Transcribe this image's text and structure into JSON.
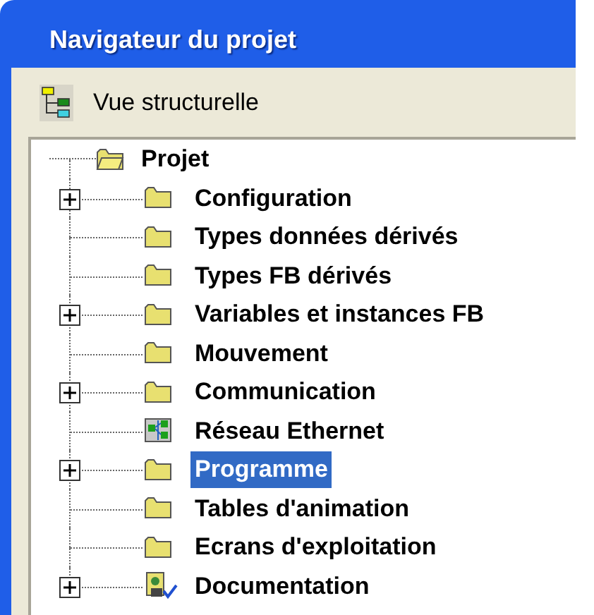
{
  "window": {
    "title": "Navigateur du projet"
  },
  "view": {
    "label": "Vue structurelle"
  },
  "tree": {
    "label": "Projet",
    "kind": "open_folder",
    "children": [
      {
        "label": "Configuration",
        "kind": "folder",
        "expandable": true,
        "selected": false
      },
      {
        "label": "Types données dérivés",
        "kind": "folder",
        "expandable": false,
        "selected": false
      },
      {
        "label": "Types FB dérivés",
        "kind": "folder",
        "expandable": false,
        "selected": false
      },
      {
        "label": "Variables et instances FB",
        "kind": "folder",
        "expandable": true,
        "selected": false
      },
      {
        "label": "Mouvement",
        "kind": "folder",
        "expandable": false,
        "selected": false
      },
      {
        "label": "Communication",
        "kind": "folder",
        "expandable": true,
        "selected": false
      },
      {
        "label": "Réseau Ethernet",
        "kind": "network",
        "expandable": false,
        "selected": false
      },
      {
        "label": "Programme",
        "kind": "folder",
        "expandable": true,
        "selected": true
      },
      {
        "label": "Tables d'animation",
        "kind": "folder",
        "expandable": false,
        "selected": false
      },
      {
        "label": "Ecrans d'exploitation",
        "kind": "folder",
        "expandable": false,
        "selected": false
      },
      {
        "label": "Documentation",
        "kind": "document",
        "expandable": true,
        "selected": false
      }
    ]
  }
}
